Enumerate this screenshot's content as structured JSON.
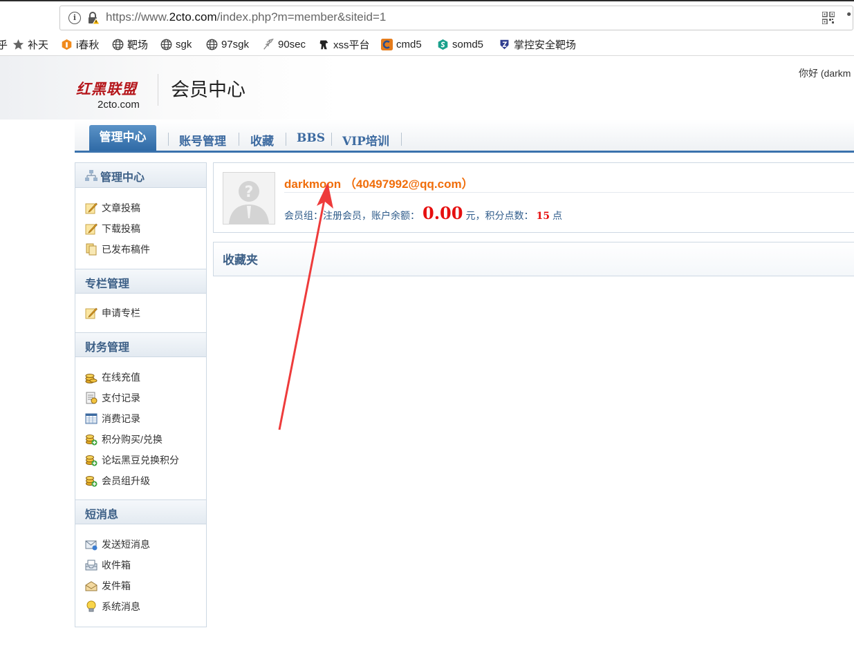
{
  "browser": {
    "url_prefix": "https://www.",
    "url_domain": "2cto.com",
    "url_path": "/index.php?m=member&siteid=1",
    "more_glyph": "•",
    "bookmarks": [
      {
        "label": "补天",
        "icon": "star-icon"
      },
      {
        "label": "i春秋",
        "icon": "ichunqiu-icon"
      },
      {
        "label": "靶场",
        "icon": "globe-icon"
      },
      {
        "label": "sgk",
        "icon": "globe-icon"
      },
      {
        "label": "97sgk",
        "icon": "globe-icon"
      },
      {
        "label": "90sec",
        "icon": "feather-icon"
      },
      {
        "label": "xss平台",
        "icon": "horse-icon"
      },
      {
        "label": "cmd5",
        "icon": "cmd5-icon"
      },
      {
        "label": "somd5",
        "icon": "somd5-icon"
      },
      {
        "label": "掌控安全靶场",
        "icon": "shield-icon"
      }
    ],
    "left_edge_fragment": "乎"
  },
  "header": {
    "logo_cn": "红黑联盟",
    "logo_en": "2cto.com",
    "title": "会员中心",
    "greeting": "你好 (darkm"
  },
  "nav": {
    "active": "管理中心",
    "items": [
      "账号管理",
      "收藏",
      "BBS",
      "VIP培训"
    ]
  },
  "sidebar": {
    "sections": [
      {
        "title": "管理中心",
        "items": [
          "文章投稿",
          "下载投稿",
          "已发布稿件"
        ]
      },
      {
        "title": "专栏管理",
        "items": [
          "申请专栏"
        ]
      },
      {
        "title": "财务管理",
        "items": [
          "在线充值",
          "支付记录",
          "消费记录",
          "积分购买/兑换",
          "论坛黑豆兑换积分",
          "会员组升级"
        ]
      },
      {
        "title": "短消息",
        "items": [
          "发送短消息",
          "收件箱",
          "发件箱",
          "系统消息"
        ]
      }
    ]
  },
  "profile": {
    "username": "darkmoon",
    "email": "（40497992@qq.com）",
    "group_label": "会员组：注册会员，账户余额：",
    "balance": "0.00",
    "balance_unit": "元，积分点数：",
    "points": "15",
    "points_unit": "点"
  },
  "favorites": {
    "title": "收藏夹"
  },
  "colors": {
    "username_orange": "#f06d0a",
    "money_red": "#e60f0f",
    "nav_blue": "#3a72ad",
    "annotation_arrow": "#ee3b3b"
  }
}
